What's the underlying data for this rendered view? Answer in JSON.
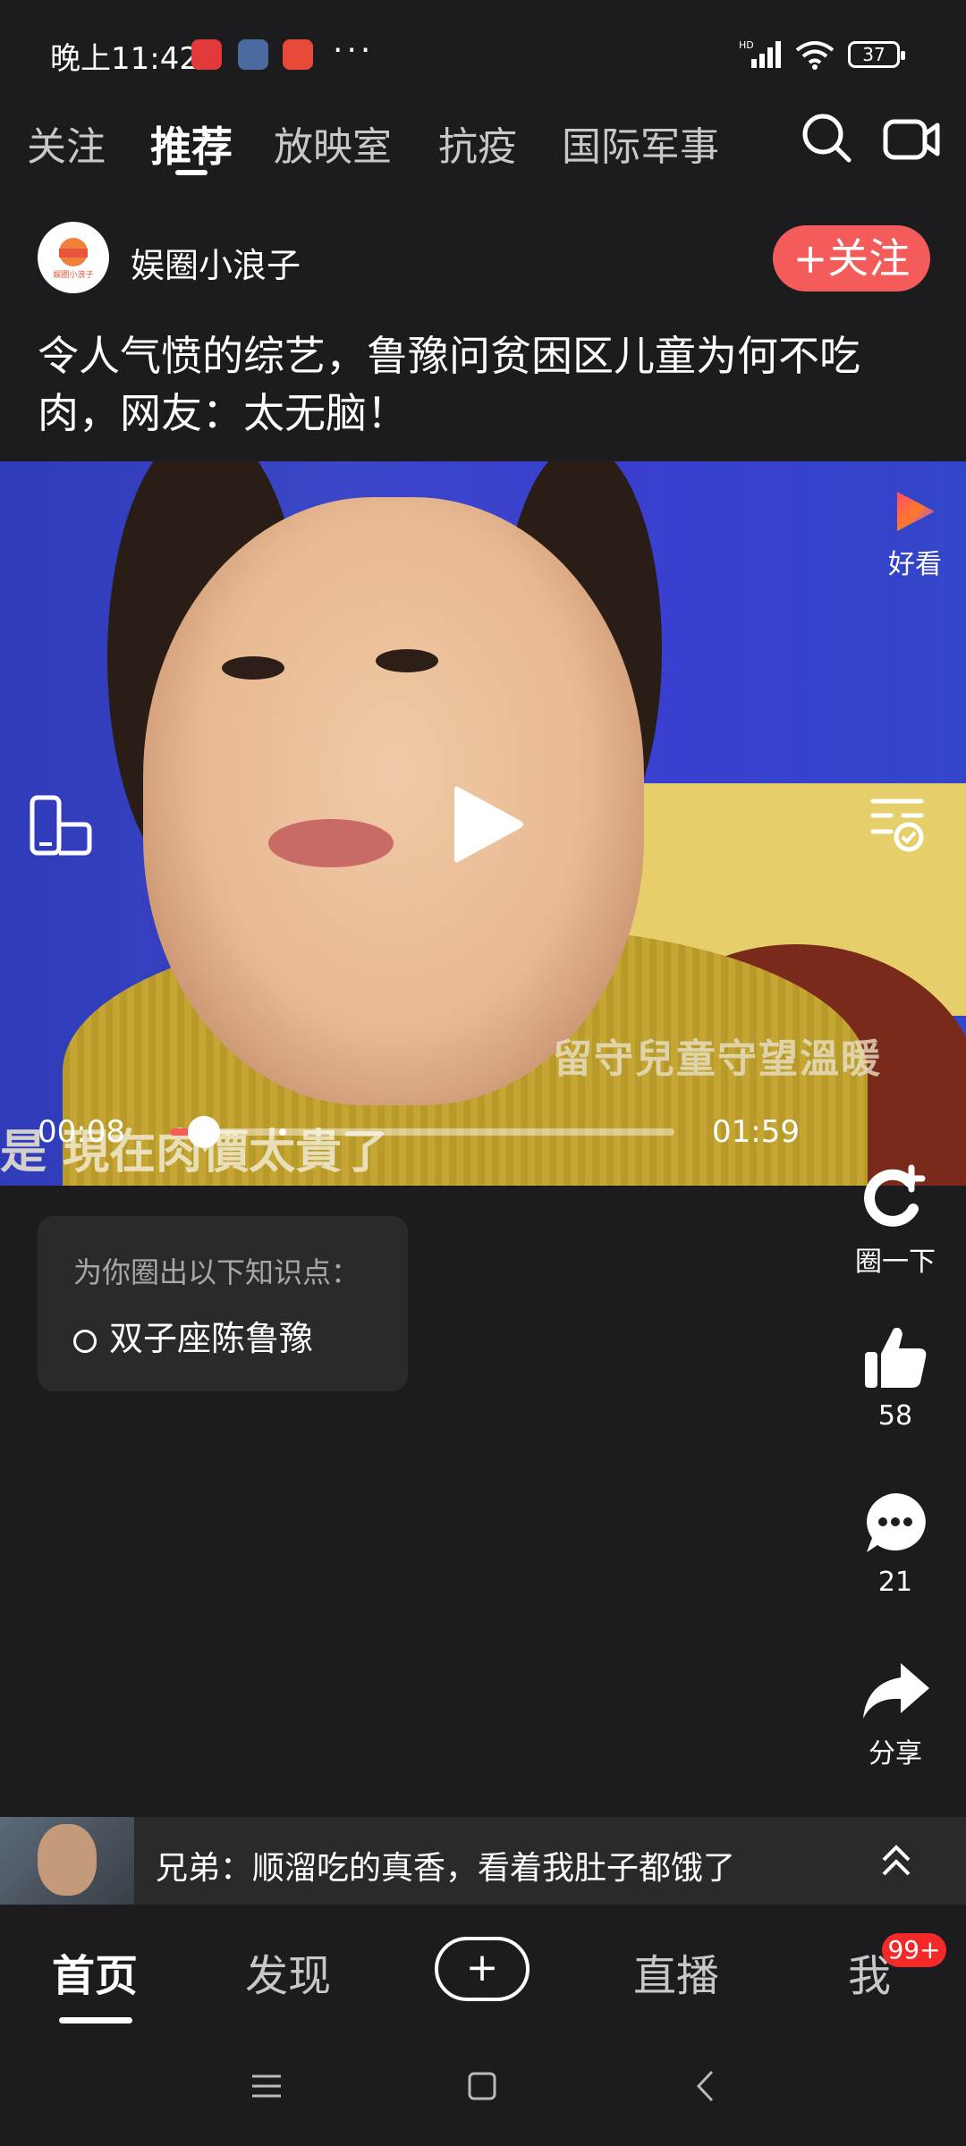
{
  "status_bar": {
    "time": "晚上11:42",
    "more_indicator": "···",
    "network_label": "HD",
    "battery": "37"
  },
  "top_tabs": {
    "items": [
      "关注",
      "推荐",
      "放映室",
      "抗疫",
      "国际军事"
    ],
    "active": "推荐"
  },
  "author": {
    "name": "娱圈小浪子",
    "avatar_text": "娱圈小浪子",
    "follow_label": "+关注"
  },
  "post": {
    "title": "令人气愤的综艺，鲁豫问贫困区儿童为何不吃肉，网友：太无脑！"
  },
  "video": {
    "brand_label": "好看",
    "overlay_caption": "留守兒童守望溫暖",
    "subtitle": "是 現在肉價太貴了",
    "current_time": "00:08",
    "total_time": "01:59",
    "progress": 0.067
  },
  "knowledge": {
    "title": "为你圈出以下知识点：",
    "item": "双子座陈鲁豫"
  },
  "side_actions": {
    "circle_label": "圈一下",
    "like_count": "58",
    "comment_count": "21",
    "share_label": "分享"
  },
  "related": {
    "text": "兄弟：顺溜吃的真香，看着我肚子都饿了"
  },
  "bottom_nav": {
    "home": "首页",
    "discover": "发现",
    "publish": "+",
    "live": "直播",
    "me": "我",
    "me_badge": "99+"
  },
  "colors": {
    "background": "#1c1c1e",
    "accent": "#f45b5b",
    "badge": "#f42a2a"
  }
}
